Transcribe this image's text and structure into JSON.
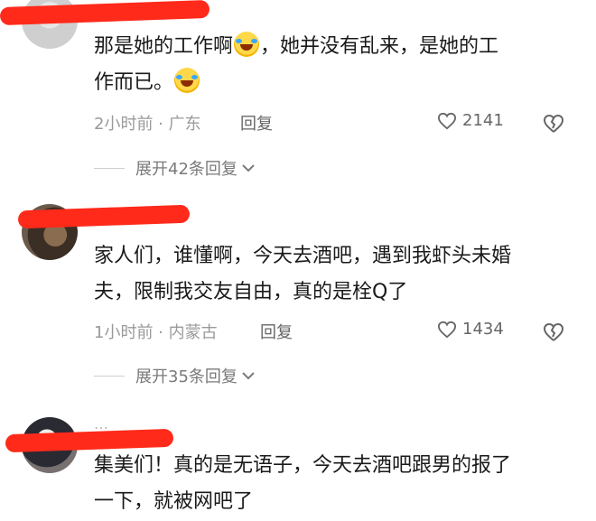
{
  "comments": [
    {
      "text_part1": "那是她的工作啊",
      "text_part2": "，她并没有乱来，是她的工",
      "text_part3": "作而已。",
      "emoji": "laugh-cry-emoji",
      "meta": "2小时前 · 广东",
      "reply_label": "回复",
      "likes": "2141",
      "expand_label": "展开42条回复"
    },
    {
      "name_partial": "…",
      "text_line1": "家人们，谁懂啊，今天去酒吧，遇到我虾头未婚",
      "text_line2": "夫，限制我交友自由，真的是栓Q了",
      "meta": "1小时前 · 内蒙古",
      "reply_label": "回复",
      "likes": "1434",
      "expand_label": "展开35条回复"
    },
    {
      "name_partial": "…",
      "text_line1": "集美们！真的是无语子，今天去酒吧跟男的报了",
      "text_line2": "一下，就被网吧了"
    }
  ],
  "colors": {
    "redaction": "#ff2a1a",
    "meta": "#9a9a9a"
  }
}
